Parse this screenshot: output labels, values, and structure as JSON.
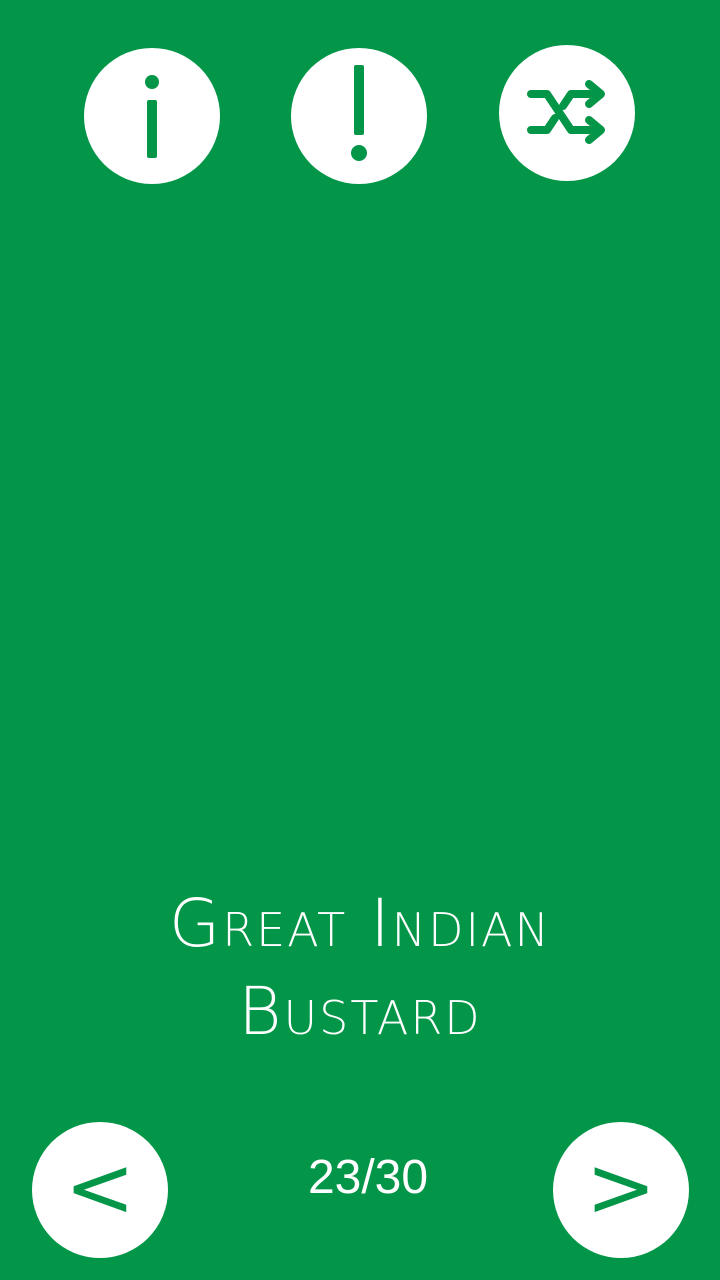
{
  "app": {
    "background_color": "#049648",
    "accent_color": "#ffffff"
  },
  "toolbar": {
    "info_icon": "info-icon",
    "alert_icon": "exclamation-icon",
    "shuffle_icon": "shuffle-icon"
  },
  "card": {
    "title": "Great Indian Bustard"
  },
  "navigation": {
    "prev_label": "<",
    "next_label": ">",
    "counter": "23/30"
  }
}
